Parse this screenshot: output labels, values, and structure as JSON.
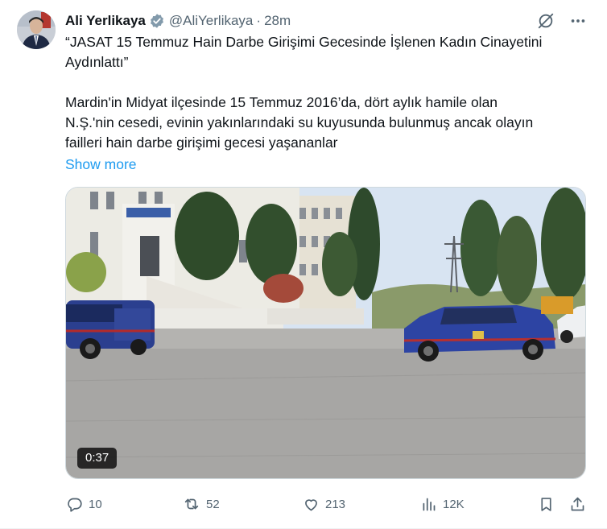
{
  "author": {
    "display_name": "Ali Yerlikaya",
    "handle": "@AliYerlikaya",
    "separator": "·",
    "time": "28m"
  },
  "tweet": {
    "text": "“JASAT 15 Temmuz Hain Darbe Girişimi Gecesinde İşlenen Kadın Cinayetini\nAydınlattı”\n\nMardin'in Midyat ilçesinde 15 Temmuz 2016’da, dört aylık hamile olan\nN.Ş.'nin cesedi, evinin yakınlarındaki su kuyusunda bulunmuş ancak olayın\nfailleri hain darbe girişimi gecesi yaşananlar",
    "show_more": "Show more"
  },
  "media": {
    "duration": "0:37"
  },
  "actions": {
    "replies": "10",
    "reposts": "52",
    "likes": "213",
    "views": "12K"
  },
  "colors": {
    "text": "#0f1419",
    "secondary": "#536471",
    "link": "#1d9bf0",
    "verified": "#829aab"
  },
  "icons": {
    "verified": "verified-badge-icon",
    "grok": "grok-icon",
    "more": "more-icon",
    "reply": "reply-icon",
    "repost": "repost-icon",
    "like": "like-icon",
    "views": "views-icon",
    "bookmark": "bookmark-icon",
    "share": "share-icon"
  }
}
